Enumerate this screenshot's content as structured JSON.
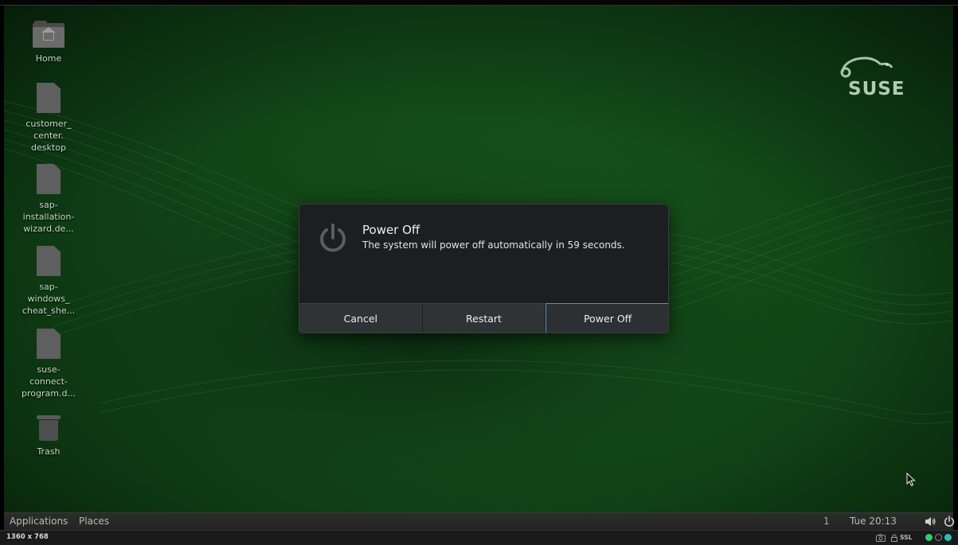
{
  "desktop": {
    "icons": [
      {
        "label": "Home",
        "icon": "home-folder-icon"
      },
      {
        "label": "customer_\ncenter.\ndesktop",
        "icon": "document-icon"
      },
      {
        "label": "sap-\ninstallation-\nwizard.de...",
        "icon": "document-icon"
      },
      {
        "label": "sap-\nwindows_\ncheat_she...",
        "icon": "document-icon"
      },
      {
        "label": "suse-\nconnect-\nprogram.d...",
        "icon": "document-icon"
      },
      {
        "label": "Trash",
        "icon": "trash-icon"
      }
    ],
    "logo_text": "SUSE"
  },
  "dialog": {
    "title": "Power Off",
    "message": "The system will power off automatically in 59 seconds.",
    "buttons": {
      "cancel": "Cancel",
      "restart": "Restart",
      "power_off": "Power Off"
    },
    "icon": "power-icon"
  },
  "panel": {
    "applications": "Applications",
    "places": "Places",
    "workspace": "1",
    "clock": "Tue 20:13"
  },
  "viewer_status": {
    "resolution": "1360 x 768",
    "ssl": "SSL"
  },
  "colors": {
    "desktop_green": "#1f6a22",
    "dialog_bg": "#1c1e1f",
    "default_button_border": "#4a90d9",
    "status_green": "#2ecc71",
    "status_teal": "#27c0b0"
  }
}
